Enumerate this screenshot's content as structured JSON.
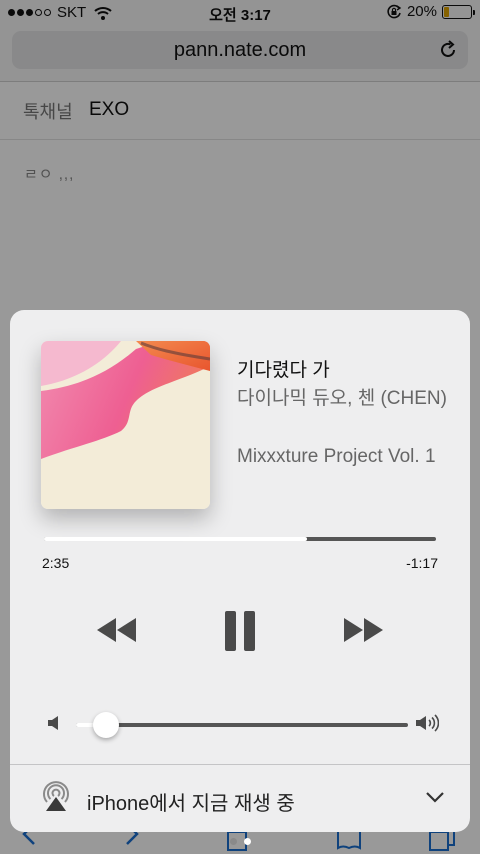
{
  "status_bar": {
    "carrier": "SKT",
    "time": "오전 3:17",
    "battery_text": "20%",
    "battery_level": 0.2,
    "battery_color": "#e0a400"
  },
  "browser": {
    "url": "pann.nate.com",
    "reload_icon": "reload-icon"
  },
  "page": {
    "row_label": "톡채널",
    "row_value": "EXO",
    "comment": "ㄹㅇ ,,,"
  },
  "now_playing": {
    "title": "기다렸다 가",
    "artist": "다이나믹 듀오, 첸 (CHEN)",
    "album": "Mixxxture Project Vol. 1",
    "elapsed": "2:35",
    "remaining": "-1:17",
    "progress": 0.67,
    "volume": 0.09,
    "controls": {
      "rewind_icon": "rewind-icon",
      "pause_icon": "pause-icon",
      "forward_icon": "fast-forward-icon"
    }
  },
  "airplay": {
    "label": "iPhone에서 지금 재생 중",
    "icon": "airplay-icon",
    "expand_icon": "chevron-down-icon"
  },
  "pager": {
    "pages": 2,
    "active": 2
  }
}
